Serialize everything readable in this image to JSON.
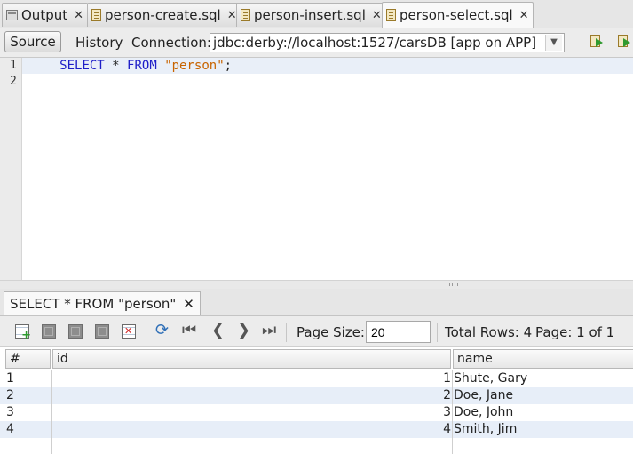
{
  "tabs": [
    {
      "label": "Output",
      "close": "✕"
    },
    {
      "label": "person-create.sql",
      "close": "✕"
    },
    {
      "label": "person-insert.sql",
      "close": "✕"
    },
    {
      "label": "person-select.sql",
      "close": "✕"
    }
  ],
  "editor_toolbar": {
    "source_label": "Source",
    "history_label": "History",
    "connection_label": "Connection:",
    "connection_value": "jdbc:derby://localhost:1527/carsDB [app on APP]"
  },
  "editor": {
    "line_numbers": [
      "1",
      "2"
    ],
    "line1": {
      "kw1": "SELECT",
      "mid": " * ",
      "kw2": "FROM",
      "sp": " ",
      "str": "\"person\"",
      "end": ";"
    }
  },
  "result_tab": {
    "label": "SELECT * FROM \"person\"",
    "close": "✕"
  },
  "result_toolbar": {
    "page_size_label": "Page Size:",
    "page_size_value": "20",
    "total_rows_text": "Total Rows: 4",
    "page_text": "Page: 1 of 1"
  },
  "grid": {
    "columns": [
      "#",
      "id",
      "name"
    ],
    "rows": [
      {
        "num": "1",
        "id": "1",
        "name": "Shute, Gary"
      },
      {
        "num": "2",
        "id": "2",
        "name": "Doe, Jane"
      },
      {
        "num": "3",
        "id": "3",
        "name": "Doe, John"
      },
      {
        "num": "4",
        "id": "4",
        "name": "Smith, Jim"
      }
    ]
  }
}
